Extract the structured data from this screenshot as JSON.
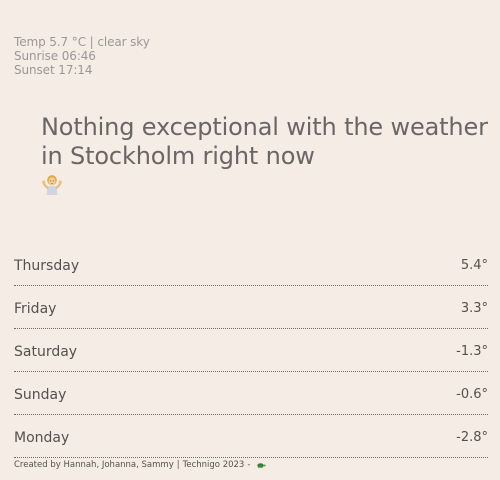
{
  "summary": {
    "temp_line": "Temp 5.7 °C | clear sky",
    "sunrise": "Sunrise 06:46",
    "sunset": "Sunset 17:14"
  },
  "headline": {
    "text": "Nothing exceptional with the weather in Stockholm right now",
    "emoji_icon": "person-shrugging-icon"
  },
  "forecast": [
    {
      "day": "Thursday",
      "temp": "5.4°"
    },
    {
      "day": "Friday",
      "temp": "3.3°"
    },
    {
      "day": "Saturday",
      "temp": "-1.3°"
    },
    {
      "day": "Sunday",
      "temp": "-0.6°"
    },
    {
      "day": "Monday",
      "temp": "-2.8°"
    }
  ],
  "footer": {
    "credits": "Created by Hannah, Johanna, Sammy",
    "org": "Technigo 2023",
    "separator": "|",
    "dash": "-",
    "icon": "turtle-icon"
  },
  "colors": {
    "background": "#f6ece6",
    "text": "#555050",
    "muted": "#9b9797"
  }
}
